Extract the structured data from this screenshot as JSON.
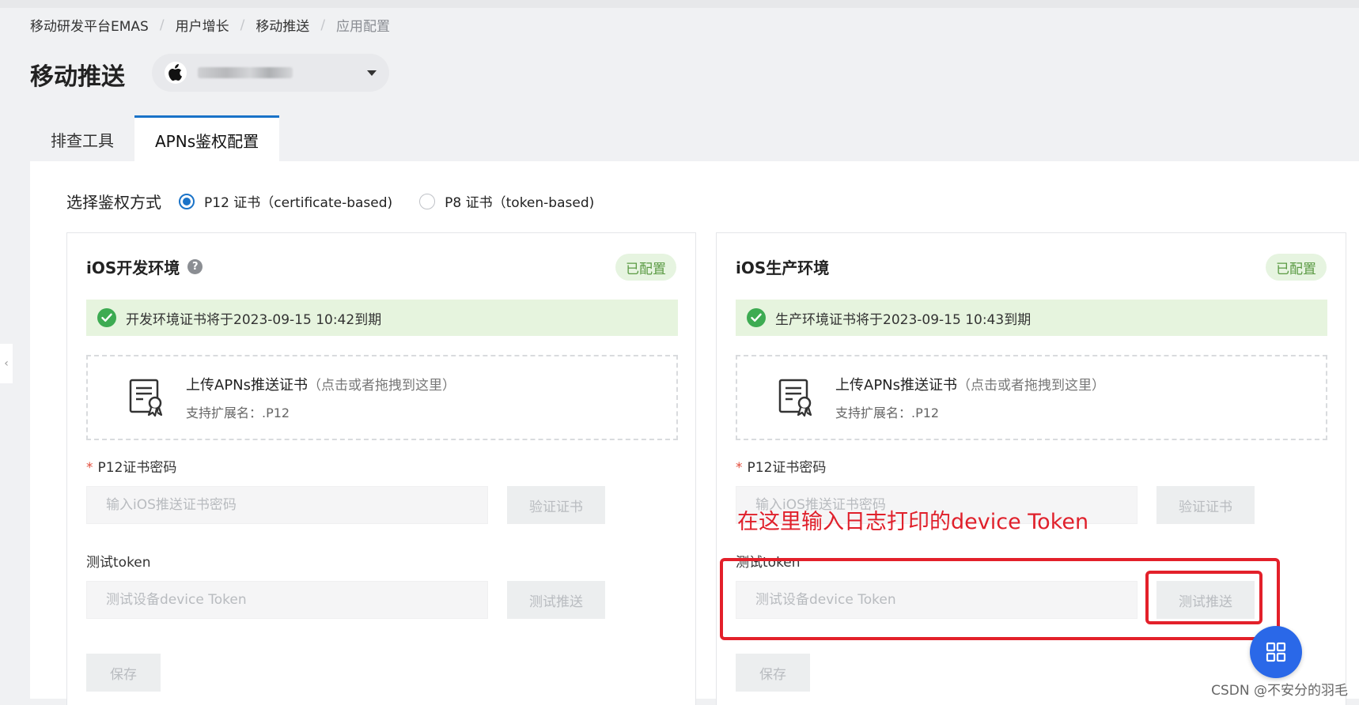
{
  "breadcrumb": {
    "items": [
      "移动研发平台EMAS",
      "用户增长",
      "移动推送",
      "应用配置"
    ],
    "separator": "/"
  },
  "header": {
    "title": "移动推送",
    "app_select": {
      "icon": "apple-icon",
      "value_blurred": true
    }
  },
  "tabs": [
    {
      "label": "排查工具",
      "active": false
    },
    {
      "label": "APNs鉴权配置",
      "active": true
    }
  ],
  "auth": {
    "label": "选择鉴权方式",
    "options": [
      {
        "label": "P12 证书（certificate-based)",
        "selected": true
      },
      {
        "label": "P8 证书（token-based)",
        "selected": false
      }
    ]
  },
  "dev": {
    "title": "iOS开发环境",
    "help_icon": "?",
    "badge": "已配置",
    "alert": "开发环境证书将于2023-09-15 10:42到期",
    "upload_title": "上传APNs推送证书",
    "upload_hint": "（点击或者拖拽到这里）",
    "upload_ext": "支持扩展名：.P12",
    "password_label": "P12证书密码",
    "password_placeholder": "输入iOS推送证书密码",
    "verify_button": "验证证书",
    "token_label": "测试token",
    "token_placeholder": "测试设备device Token",
    "test_button": "测试推送",
    "save_button": "保存"
  },
  "prod": {
    "title": "iOS生产环境",
    "badge": "已配置",
    "alert": "生产环境证书将于2023-09-15 10:43到期",
    "upload_title": "上传APNs推送证书",
    "upload_hint": "（点击或者拖拽到这里）",
    "upload_ext": "支持扩展名：.P12",
    "password_label": "P12证书密码",
    "password_placeholder": "输入iOS推送证书密码",
    "verify_button": "验证证书",
    "token_label": "测试token",
    "token_placeholder": "测试设备device Token",
    "test_button": "测试推送",
    "save_button": "保存"
  },
  "annotation": {
    "text": "在这里输入日志打印的device Token",
    "color": "#e0202b"
  },
  "watermark": "CSDN @不安分的羽毛",
  "colors": {
    "accent": "#1a73c8",
    "success": "#3dab52",
    "badge_text": "#5a9a43",
    "fab": "#2a68e8"
  }
}
